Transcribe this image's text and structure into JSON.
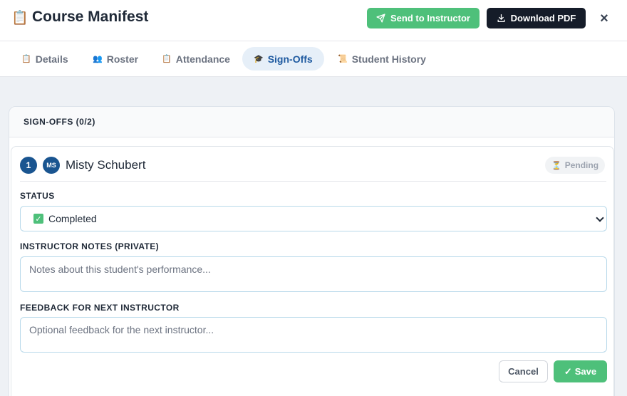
{
  "header": {
    "title": "Course Manifest",
    "title_icon": "clipboard-icon",
    "send_label": "Send to Instructor",
    "download_label": "Download PDF",
    "close_symbol": "×"
  },
  "tabs": [
    {
      "label": "Details",
      "icon": "clipboard-icon",
      "active": false
    },
    {
      "label": "Roster",
      "icon": "people-icon",
      "active": false
    },
    {
      "label": "Attendance",
      "icon": "clipboard-icon",
      "active": false
    },
    {
      "label": "Sign-Offs",
      "icon": "graduation-cap-icon",
      "active": true
    },
    {
      "label": "Student History",
      "icon": "scroll-icon",
      "active": false
    }
  ],
  "signoffs": {
    "heading": "SIGN-OFFS (0/2)",
    "entry": {
      "number": "1",
      "initials": "MS",
      "name": "Misty Schubert",
      "status_badge": "Pending",
      "status_label": "STATUS",
      "status_value": "Completed",
      "notes_label": "INSTRUCTOR NOTES (PRIVATE)",
      "notes_placeholder": "Notes about this student's performance...",
      "feedback_label": "FEEDBACK FOR NEXT INSTRUCTOR",
      "feedback_placeholder": "Optional feedback for the next instructor...",
      "cancel_label": "Cancel",
      "save_label": "Save"
    }
  },
  "colors": {
    "accent_green": "#4ec07a",
    "dark_button": "#151c29",
    "brand_blue": "#1a5590",
    "active_tab_bg": "#e6eff8"
  }
}
